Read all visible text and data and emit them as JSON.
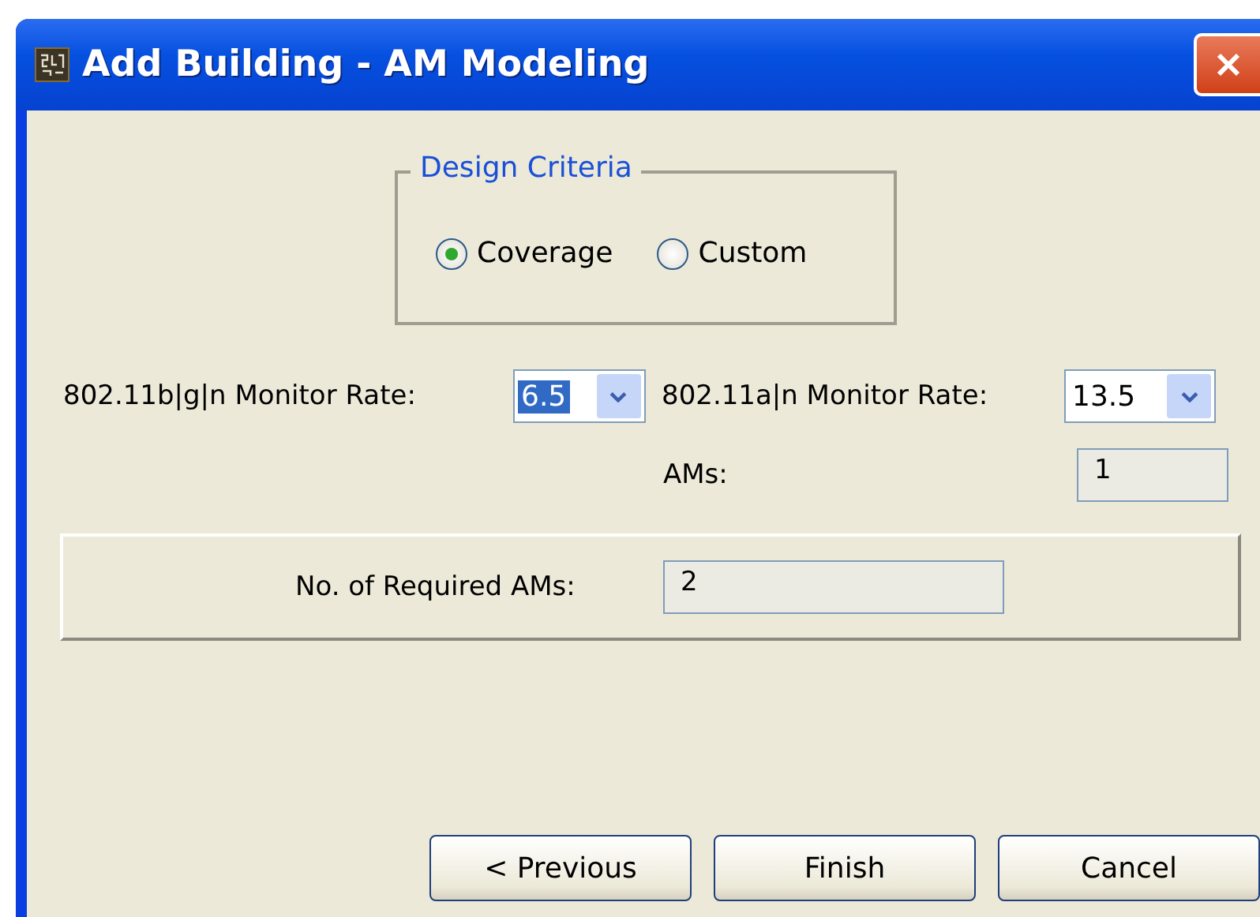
{
  "window": {
    "title": "Add Building - AM Modeling"
  },
  "design_criteria": {
    "title": "Design Criteria",
    "options": [
      {
        "label": "Coverage",
        "selected": true
      },
      {
        "label": "Custom",
        "selected": false
      }
    ]
  },
  "bgn_rate": {
    "label": "802.11b|g|n Monitor Rate:",
    "value": "6.5",
    "focused": true
  },
  "an_rate": {
    "label": "802.11a|n Monitor Rate:",
    "value": "13.5",
    "focused": false
  },
  "ams": {
    "label": "AMs:",
    "value": "1"
  },
  "required": {
    "label": "No. of Required AMs:",
    "value": "2"
  },
  "buttons": [
    "< Previous",
    "Finish",
    "Cancel"
  ]
}
